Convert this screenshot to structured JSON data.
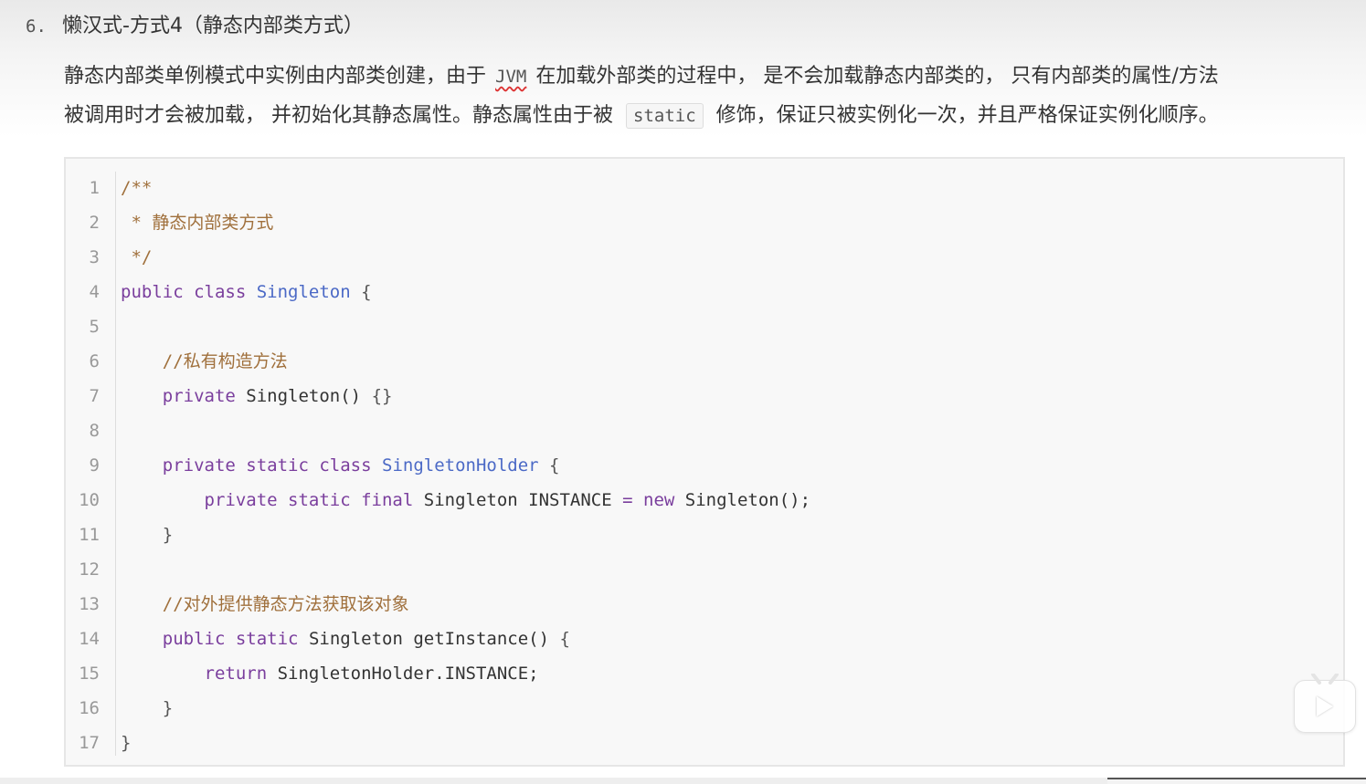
{
  "heading": {
    "number": "6.",
    "title": "懒汉式-方式4（静态内部类方式）"
  },
  "paragraph": {
    "line1_a": "静态内部类单例模式中实例由内部类创建，由于",
    "line1_code": "JVM",
    "line1_b": "在加载外部类的过程中， 是不会加载静态内部类的， 只有内部类的属性/方法",
    "line2_a": "被调用时才会被加载， 并初始化其静态属性。静态属性由于被",
    "line2_code": "static",
    "line2_b": "修饰，保证只被实例化一次，并且严格保证实例化顺序。"
  },
  "code": {
    "line_numbers": [
      "1",
      "2",
      "3",
      "4",
      "5",
      "6",
      "7",
      "8",
      "9",
      "10",
      "11",
      "12",
      "13",
      "14",
      "15",
      "16",
      "17"
    ],
    "l1": "/**",
    "l2": " * 静态内部类方式",
    "l3": " */",
    "l4_kw": "public class",
    "l4_cls": "Singleton",
    "l4_p": "{",
    "l6_cm": "//私有构造方法",
    "l7_kw": "private",
    "l7_rest": "Singleton()",
    "l7_p": "{}",
    "l9_kw": "private static class",
    "l9_cls": "SingletonHolder",
    "l9_p": "{",
    "l10_kw": "private static final",
    "l10_type": "Singleton INSTANCE",
    "l10_op": "=",
    "l10_new": "new",
    "l10_rest": "Singleton();",
    "l11": "}",
    "l13_cm": "//对外提供静态方法获取该对象",
    "l14_kw": "public static",
    "l14_rest": "Singleton getInstance()",
    "l14_p": "{",
    "l15_kw": "return",
    "l15_rest": "SingletonHolder.INSTANCE;",
    "l16": "}",
    "l17": "}"
  },
  "colors": {
    "keyword": "#7a3e9d",
    "class_name": "#4b69c6",
    "comment": "#a0703c",
    "line_number": "#999999"
  },
  "icons": {
    "play": "bilibili-play-icon"
  }
}
